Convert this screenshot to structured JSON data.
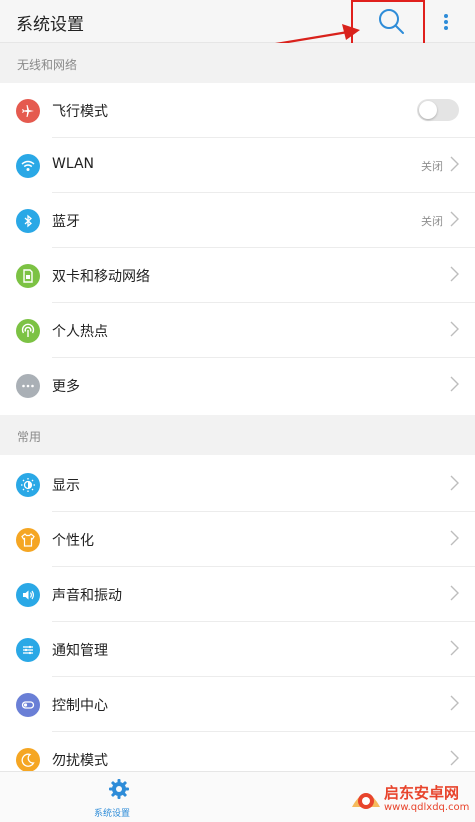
{
  "header": {
    "title": "系统设置",
    "search_icon": "search-icon",
    "more_icon": "vertical-dots-icon"
  },
  "sections": [
    {
      "title": "无线和网络",
      "items": [
        {
          "label": "飞行模式",
          "icon": "airplane-icon",
          "color": "#e55a4f",
          "control": "toggle",
          "toggle_on": false
        },
        {
          "label": "WLAN",
          "icon": "wifi-icon",
          "color": "#2aa8e6",
          "value": "关闭"
        },
        {
          "label": "蓝牙",
          "icon": "bluetooth-icon",
          "color": "#2aa8e6",
          "value": "关闭"
        },
        {
          "label": "双卡和移动网络",
          "icon": "sim-card-icon",
          "color": "#7cc244"
        },
        {
          "label": "个人热点",
          "icon": "hotspot-icon",
          "color": "#7cc244"
        },
        {
          "label": "更多",
          "icon": "more-dots-icon",
          "color": "#aab0b6"
        }
      ]
    },
    {
      "title": "常用",
      "items": [
        {
          "label": "显示",
          "icon": "brightness-icon",
          "color": "#2aa8e6"
        },
        {
          "label": "个性化",
          "icon": "shirt-icon",
          "color": "#f5a623"
        },
        {
          "label": "声音和振动",
          "icon": "speaker-icon",
          "color": "#2aa8e6"
        },
        {
          "label": "通知管理",
          "icon": "notification-sliders-icon",
          "color": "#2aa8e6"
        },
        {
          "label": "控制中心",
          "icon": "toggle-switch-icon",
          "color": "#6a7fd6"
        },
        {
          "label": "勿扰模式",
          "icon": "moon-icon",
          "color": "#f5a623"
        }
      ]
    }
  ],
  "bottom_nav": {
    "label": "系统设置",
    "icon": "gear-icon",
    "accent": "#2e8cd8"
  },
  "watermark": {
    "line1": "启东安卓网",
    "line2": "www.qdlxdq.com"
  }
}
